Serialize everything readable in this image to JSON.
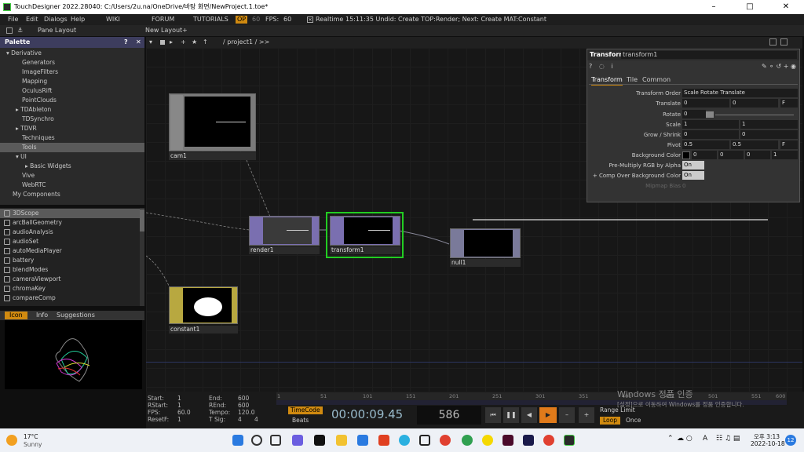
{
  "window": {
    "title": "TouchDesigner 2022.28040: C:/Users/2u.na/OneDrive/바탕 화면/NewProject.1.toe*"
  },
  "menu": {
    "file": "File",
    "edit": "Edit",
    "dialogs": "Dialogs",
    "help": "Help",
    "wiki": "WIKI",
    "forum": "FORUM",
    "tutorials": "TUTORIALS",
    "op": "OP",
    "fps_label": "FPS:",
    "fps_value": "60",
    "realtime": "Realtime",
    "status": "15:11:35 Undid: Create TOP:Render; Next: Create MAT:Constant",
    "badge_num": "60"
  },
  "toolbar": {
    "pane_layout": "Pane Layout",
    "new_layout": "New Layout"
  },
  "palette": {
    "title": "Palette",
    "tree": [
      "Derivative",
      "Generators",
      "ImageFilters",
      "Mapping",
      "OculusRift",
      "PointClouds",
      "TDAbleton",
      "TDSynchro",
      "TDVR",
      "Techniques",
      "Tools",
      "UI",
      "Basic Widgets",
      "Vive",
      "WebRTC",
      "My Components"
    ],
    "list": [
      "3DScope",
      "arcBallGeometry",
      "audioAnalysis",
      "audioSet",
      "autoMediaPlayer",
      "battery",
      "blendModes",
      "cameraViewport",
      "chromaKey",
      "compareComp"
    ],
    "tabs": [
      "Icon",
      "Info",
      "Suggestions"
    ]
  },
  "network": {
    "path": "/ project1 / >>"
  },
  "nodes": {
    "cam": "cam1",
    "render": "render1",
    "transform": "transform1",
    "null": "null1",
    "constant": "constant1"
  },
  "params": {
    "op_type": "Transform",
    "op_name": "transform1",
    "tabs": [
      "Transform",
      "Tile",
      "Common"
    ],
    "transform_order_label": "Transform Order",
    "transform_order": "Scale Rotate Translate",
    "translate_label": "Translate",
    "translate_x": "0",
    "translate_y": "0",
    "unit": "F",
    "rotate_label": "Rotate",
    "rotate": "0",
    "scale_label": "Scale",
    "scale_x": "1",
    "scale_y": "1",
    "grow_label": "Grow / Shrink",
    "grow_x": "0",
    "grow_y": "0",
    "pivot_label": "Pivot",
    "pivot_x": "0.5",
    "pivot_y": "0.5",
    "bg_label": "Background Color",
    "bg_r": "0",
    "bg_g": "0",
    "bg_b": "0",
    "bg_a": "1",
    "premult_label": "Pre-Multiply RGB by Alpha",
    "premult": "On",
    "comp_label": "+ Comp Over Background Color",
    "comp": "On",
    "mipmap_label": "Mipmap Bias",
    "mipmap": "0"
  },
  "timeline": {
    "start_label": "Start:",
    "start": "1",
    "rstart_label": "RStart:",
    "rstart": "1",
    "fps_label": "FPS:",
    "fps": "60.0",
    "resetf_label": "ResetF:",
    "resetf": "1",
    "end_label": "End:",
    "end": "600",
    "rend_label": "REnd:",
    "rend": "600",
    "tempo_label": "Tempo:",
    "tempo": "120.0",
    "tsig_label": "T Sig:",
    "tsig_a": "4",
    "tsig_b": "4",
    "timecode": "TimeCode",
    "beats": "Beats",
    "time": "00:00:09.45",
    "frame": "586",
    "range_limit": "Range Limit",
    "loop": "Loop",
    "once": "Once",
    "ruler": [
      "1",
      "51",
      "101",
      "151",
      "201",
      "251",
      "301",
      "351",
      "401",
      "451",
      "501",
      "551",
      "600"
    ],
    "watermark1": "Windows 정품 인증",
    "watermark2": "[설정]으로 이동하여 Windows를 정품 인증합니다."
  },
  "taskbar": {
    "temp": "17°C",
    "weather": "Sunny",
    "time": "오후 3:13",
    "date": "2022-10-18",
    "notif": "12",
    "lang": "A"
  },
  "colors": {
    "selected": "#22cc22",
    "palette_header": "#3d3d5e",
    "top_node": "#7a6fb0",
    "comp_node": "#b8a840",
    "play": "#e07a1a"
  }
}
